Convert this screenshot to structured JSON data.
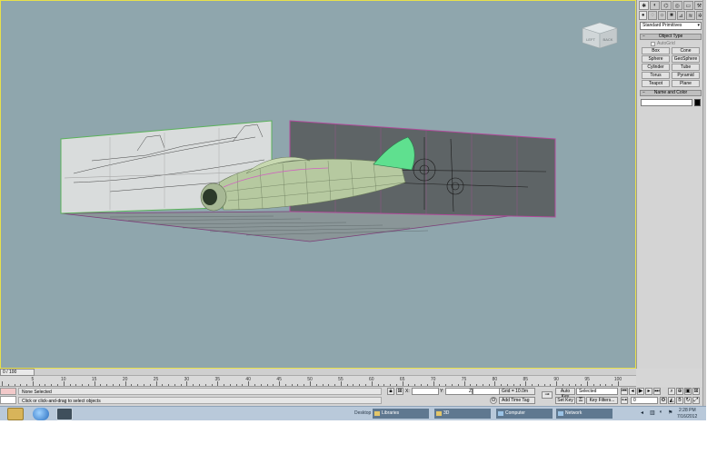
{
  "command_panel": {
    "dropdown_value": "Standard Primitives",
    "object_type_header": "Object Type",
    "autogrid_label": "AutoGrid",
    "buttons": [
      "Box",
      "Cone",
      "Sphere",
      "GeoSphere",
      "Cylinder",
      "Tube",
      "Torus",
      "Pyramid",
      "Teapot",
      "Plane"
    ],
    "name_color_header": "Name and Color"
  },
  "viewcube": {
    "left": "LEFT",
    "back": "BACK"
  },
  "timeline": {
    "slider_label": "0 / 100",
    "ticks": [
      "5",
      "10",
      "15",
      "20",
      "25",
      "30",
      "35",
      "40",
      "45",
      "50",
      "55",
      "60",
      "65",
      "70",
      "75",
      "80",
      "85",
      "90",
      "95",
      "100"
    ]
  },
  "status": {
    "selection": "None Selected",
    "prompt": "Click or click-and-drag to select objects",
    "x_label": "X:",
    "y_label": "Y:",
    "z_label": "Z:",
    "grid": "Grid = 10.0m",
    "add_time_tag": "Add Time Tag",
    "auto_key": "Auto Key",
    "selected_dropdown": "Selected",
    "set_key": "Set Key",
    "key_filters": "Key Filters...",
    "frame_value": "0"
  },
  "taskbar": {
    "desktop": "Desktop",
    "items": [
      "Libraries",
      "3D",
      "Computer",
      "Network"
    ],
    "time": "2:28 PM",
    "date": "7/16/2012"
  }
}
